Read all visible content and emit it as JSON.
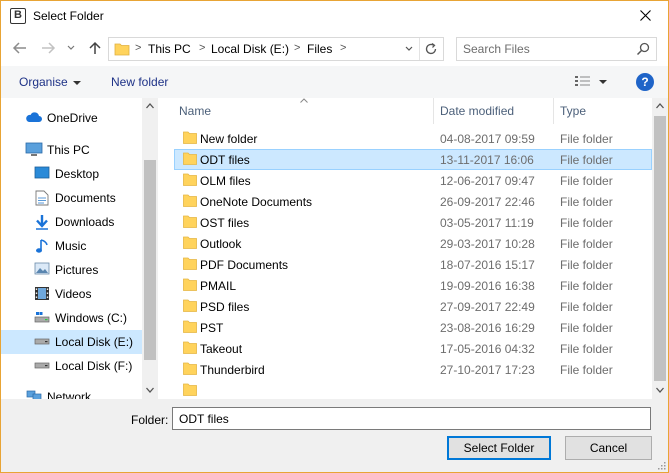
{
  "window": {
    "title": "Select Folder",
    "app_icon_letter": "B"
  },
  "navigation": {
    "breadcrumbs": [
      "This PC",
      "Local Disk (E:)",
      "Files"
    ],
    "search_placeholder": "Search Files"
  },
  "toolbar": {
    "organise_label": "Organise",
    "new_folder_label": "New folder",
    "help_label": "?"
  },
  "sidebar": {
    "items": [
      {
        "label": "OneDrive",
        "icon": "cloud-icon"
      },
      {
        "label": "This PC",
        "icon": "computer-icon"
      },
      {
        "label": "Desktop",
        "icon": "desktop-icon"
      },
      {
        "label": "Documents",
        "icon": "documents-icon"
      },
      {
        "label": "Downloads",
        "icon": "download-icon"
      },
      {
        "label": "Music",
        "icon": "music-icon"
      },
      {
        "label": "Pictures",
        "icon": "pictures-icon"
      },
      {
        "label": "Videos",
        "icon": "videos-icon"
      },
      {
        "label": "Windows (C:)",
        "icon": "drive-icon"
      },
      {
        "label": "Local Disk (E:)",
        "icon": "drive-icon",
        "selected": true
      },
      {
        "label": "Local Disk (F:)",
        "icon": "drive-icon"
      },
      {
        "label": "Network",
        "icon": "network-icon"
      }
    ]
  },
  "file_list": {
    "columns": [
      "Name",
      "Date modified",
      "Type"
    ],
    "rows": [
      {
        "name": "New folder",
        "date": "04-08-2017 09:59",
        "type": "File folder"
      },
      {
        "name": "ODT files",
        "date": "13-11-2017 16:06",
        "type": "File folder",
        "selected": true
      },
      {
        "name": "OLM files",
        "date": "12-06-2017 09:47",
        "type": "File folder"
      },
      {
        "name": "OneNote Documents",
        "date": "26-09-2017 22:46",
        "type": "File folder"
      },
      {
        "name": "OST files",
        "date": "03-05-2017 11:19",
        "type": "File folder"
      },
      {
        "name": "Outlook",
        "date": "29-03-2017 10:28",
        "type": "File folder"
      },
      {
        "name": "PDF Documents",
        "date": "18-07-2016 15:17",
        "type": "File folder"
      },
      {
        "name": "PMAIL",
        "date": "19-09-2016 16:38",
        "type": "File folder"
      },
      {
        "name": "PSD files",
        "date": "27-09-2017 22:49",
        "type": "File folder"
      },
      {
        "name": "PST",
        "date": "23-08-2016 16:29",
        "type": "File folder"
      },
      {
        "name": "Takeout",
        "date": "17-05-2016 04:32",
        "type": "File folder"
      },
      {
        "name": "Thunderbird",
        "date": "27-10-2017 17:23",
        "type": "File folder"
      }
    ]
  },
  "footer": {
    "folder_label": "Folder:",
    "folder_value": "ODT files",
    "select_button": "Select Folder",
    "cancel_button": "Cancel"
  },
  "colors": {
    "accent": "#0078d7",
    "selection": "#cce8ff",
    "folder": "#ffd35c",
    "link": "#1e3287"
  }
}
